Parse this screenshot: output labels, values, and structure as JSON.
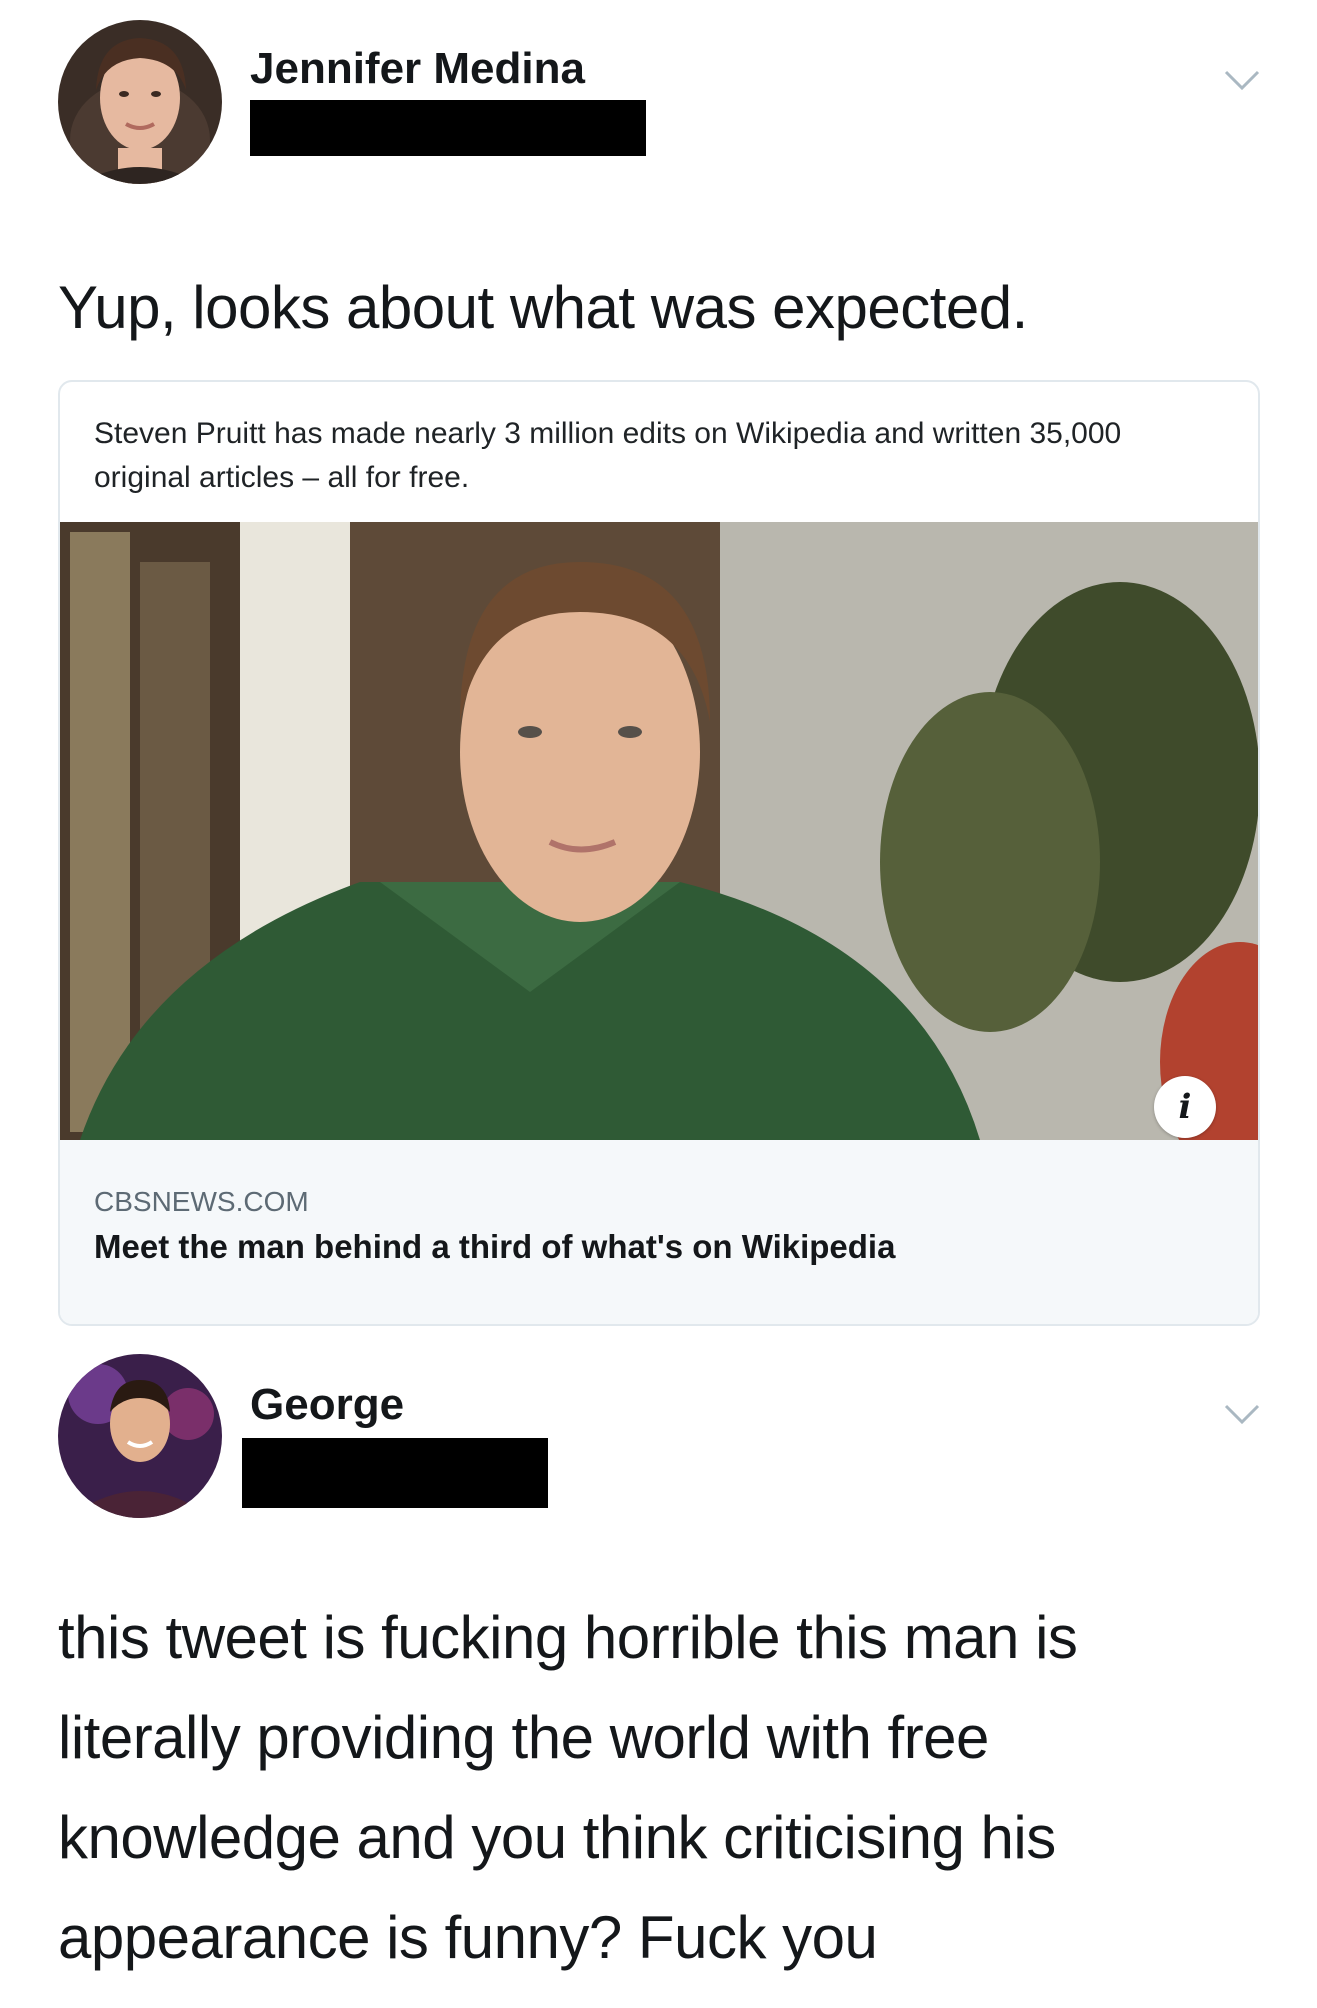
{
  "tweet1": {
    "username": "Jennifer Medina",
    "text": "Yup, looks about what was expected.",
    "card": {
      "quote": "Steven Pruitt has made nearly 3 million edits on Wikipedia and written 35,000 original articles – all for free.",
      "info_icon": "i",
      "domain": "CBSNEWS.COM",
      "title": "Meet the man behind a third of what's on Wikipedia"
    }
  },
  "tweet2": {
    "username": "George",
    "text": "this tweet is fucking horrible this man is literally providing the world with free knowledge and you think criticising his appearance is funny? Fuck you"
  },
  "colors": {
    "text": "#14171a",
    "secondary": "#5d6a74",
    "card_border": "#e1e8ed",
    "card_footer": "#f5f8fa"
  },
  "icons": [
    "chevron-down-icon",
    "info-icon"
  ]
}
